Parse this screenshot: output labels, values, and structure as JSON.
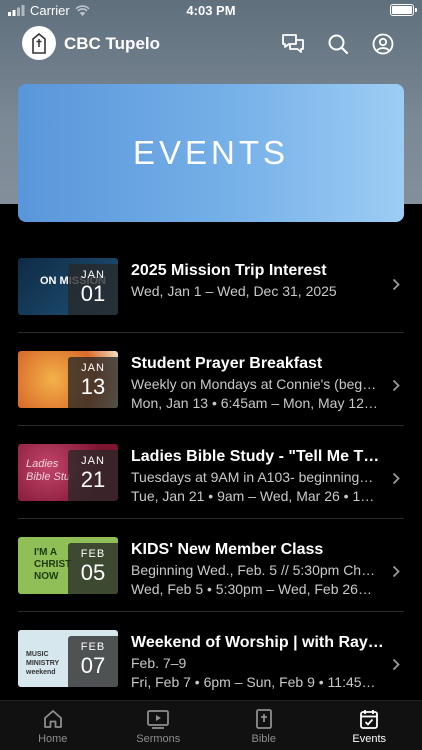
{
  "status_bar": {
    "carrier": "Carrier",
    "time": "4:03 PM"
  },
  "header": {
    "app_title": "CBC Tupelo"
  },
  "hero": {
    "title": "EVENTS"
  },
  "events": [
    {
      "title": "2025 Mission Trip Interest",
      "lines": [
        "Wed, Jan 1 – Wed, Dec 31, 2025"
      ],
      "month": "JAN",
      "day": "01",
      "thumb_text": "ON MISSION",
      "thumb_color": "#1b3e5e"
    },
    {
      "title": "Student Prayer Breakfast",
      "lines": [
        "Weekly on Mondays at Connie's (beg…",
        "Mon, Jan 13 • 6:45am – Mon, May 12…"
      ],
      "month": "JAN",
      "day": "13",
      "thumb_text": "",
      "thumb_color": "#e9a048"
    },
    {
      "title": "Ladies Bible Study - \"Tell Me T…",
      "lines": [
        "Tuesdays at 9AM in A103- beginning…",
        "Tue, Jan 21 • 9am – Wed, Mar 26 • 1…"
      ],
      "month": "JAN",
      "day": "21",
      "thumb_text": "Ladies Bible Stu",
      "thumb_color": "#8a1f3c"
    },
    {
      "title": "KIDS' New Member Class",
      "lines": [
        "Beginning Wed., Feb. 5 // 5:30pm Ch…",
        "Wed, Feb 5 • 5:30pm – Wed, Feb 26…"
      ],
      "month": "FEB",
      "day": "05",
      "thumb_text": "I'M A CHRIST NOW",
      "thumb_color": "#8fbf56"
    },
    {
      "title": "Weekend of Worship | with Ray…",
      "lines": [
        "Feb. 7–9",
        "Fri, Feb 7 • 6pm – Sun, Feb 9 • 11:45…"
      ],
      "month": "FEB",
      "day": "07",
      "thumb_text": "MUSIC MINISTRY weekend",
      "thumb_color": "#d7e7ee"
    }
  ],
  "tabs": [
    {
      "label": "Home",
      "icon": "home-icon",
      "active": false
    },
    {
      "label": "Sermons",
      "icon": "video-icon",
      "active": false
    },
    {
      "label": "Bible",
      "icon": "bible-icon",
      "active": false
    },
    {
      "label": "Events",
      "icon": "calendar-icon",
      "active": true
    }
  ]
}
